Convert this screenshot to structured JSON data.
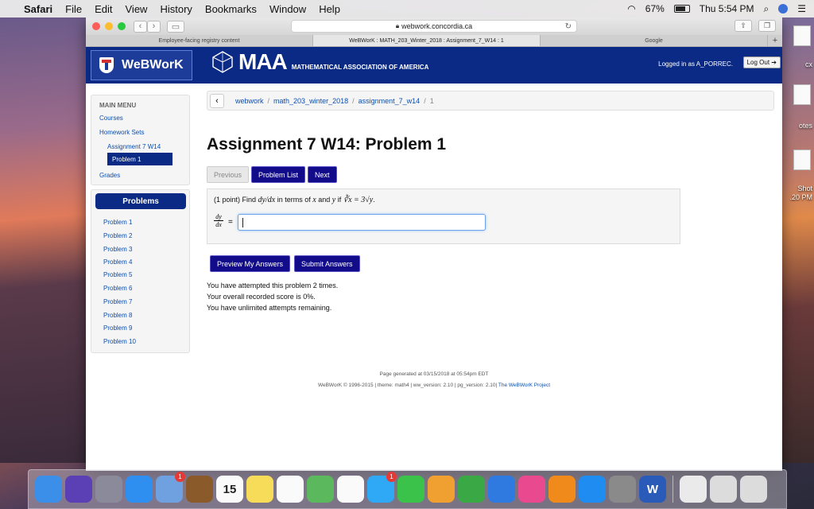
{
  "menubar": {
    "app": "Safari",
    "items": [
      "File",
      "Edit",
      "View",
      "History",
      "Bookmarks",
      "Window",
      "Help"
    ],
    "battery": "67%",
    "clock": "Thu 5:54 PM"
  },
  "browser": {
    "url": "webwork.concordia.ca",
    "tabs": [
      "Employee-facing registry content",
      "WeBWorK : MATH_203_Winter_2018 : Assignment_7_W14 : 1",
      "Google"
    ]
  },
  "desktop": {
    "labels": [
      "cx",
      "otes",
      "Shot",
      ".20 PM"
    ]
  },
  "header": {
    "logo_text": "WeBWorK",
    "maa_big": "MAA",
    "maa_small": "MATHEMATICAL ASSOCIATION OF AMERICA",
    "logged_in": "Logged in as A_PORREC.",
    "logout": "Log Out ➔"
  },
  "sidebar": {
    "title": "MAIN MENU",
    "courses": "Courses",
    "homework_sets": "Homework Sets",
    "assignment": "Assignment 7 W14",
    "problem": "Problem 1",
    "grades": "Grades"
  },
  "problems_panel": {
    "title": "Problems",
    "items": [
      "Problem 1",
      "Problem 2",
      "Problem 3",
      "Problem 4",
      "Problem 5",
      "Problem 6",
      "Problem 7",
      "Problem 8",
      "Problem 9",
      "Problem 10"
    ]
  },
  "breadcrumb": {
    "parts": [
      "webwork",
      "math_203_winter_2018",
      "assignment_7_w14"
    ],
    "current": "1"
  },
  "problem": {
    "title": "Assignment 7 W14: Problem 1",
    "prev": "Previous",
    "list": "Problem List",
    "next": "Next",
    "points": "(1 point) Find",
    "deriv": "dy/dx",
    "in_terms": "in terms of",
    "x": "x",
    "and": "and",
    "y": "y",
    "if": "if",
    "equation": "∛x = 3√y",
    "frac_top": "dy",
    "frac_bottom": "dx",
    "equals": "=",
    "answer_value": ""
  },
  "actions": {
    "preview": "Preview My Answers",
    "submit": "Submit Answers"
  },
  "messages": [
    "You have attempted this problem 2 times.",
    "Your overall recorded score is 0%.",
    "You have unlimited attempts remaining."
  ],
  "footer": {
    "generated": "Page generated at 03/15/2018 at 05:54pm EDT",
    "copyright": "WeBWorK © 1996-2015 | theme: math4 | ww_version: 2.10 | pg_version: 2.10|",
    "project": "The WeBWorK Project"
  },
  "dock": {
    "apps": [
      {
        "name": "finder-icon",
        "color": "#3b8fe8"
      },
      {
        "name": "siri-icon",
        "color": "#5b3fb5"
      },
      {
        "name": "launchpad-icon",
        "color": "#8a8a9a"
      },
      {
        "name": "safari-icon",
        "color": "#2f8ff0"
      },
      {
        "name": "mail-icon",
        "color": "#6fa0e0",
        "badge": "1"
      },
      {
        "name": "notebook-icon",
        "color": "#8b5a2b"
      },
      {
        "name": "calendar-icon",
        "color": "#fafafa",
        "text": "15"
      },
      {
        "name": "notes-icon",
        "color": "#f7dc5a"
      },
      {
        "name": "reminders-icon",
        "color": "#fafafa"
      },
      {
        "name": "maps-icon",
        "color": "#5cb85c"
      },
      {
        "name": "photos-icon",
        "color": "#fafafa"
      },
      {
        "name": "messages-icon",
        "color": "#2fa8f5",
        "badge": "1"
      },
      {
        "name": "facetime-icon",
        "color": "#3ac24a"
      },
      {
        "name": "pages-icon",
        "color": "#f0a030"
      },
      {
        "name": "numbers-icon",
        "color": "#3aa845"
      },
      {
        "name": "keynote-icon",
        "color": "#2f7ae0"
      },
      {
        "name": "itunes-icon",
        "color": "#e94a8f"
      },
      {
        "name": "ibooks-icon",
        "color": "#f08a1a"
      },
      {
        "name": "app-store-icon",
        "color": "#1e8cf0"
      },
      {
        "name": "system-preferences-icon",
        "color": "#8a8a8a"
      },
      {
        "name": "word-icon",
        "color": "#2b5bb8",
        "text": "W"
      },
      {
        "name": "preview-icon",
        "color": "#eaeaea"
      },
      {
        "name": "screenshot-stack-icon",
        "color": "#dcdcdc"
      },
      {
        "name": "trash-icon",
        "color": "#dcdcdc"
      }
    ]
  }
}
